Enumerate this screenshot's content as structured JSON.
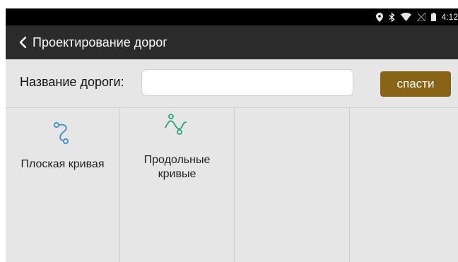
{
  "status_bar": {
    "time": "4:12",
    "icons": [
      "location-icon",
      "bluetooth-icon",
      "wifi-icon",
      "no-signal-icon",
      "battery-icon"
    ]
  },
  "app_bar": {
    "title": "Проектирование дорог",
    "back_icon": "chevron-left-icon"
  },
  "form": {
    "road_name_label": "Название дороги:",
    "road_name_value": "",
    "road_name_placeholder": "",
    "save_label": "спасти"
  },
  "tiles": [
    {
      "label": "Плоская кривая",
      "icon": "plane-curve-icon"
    },
    {
      "label": "Продольные кривые",
      "icon": "longitudinal-curve-icon"
    },
    {
      "label": "",
      "icon": ""
    },
    {
      "label": "",
      "icon": ""
    }
  ],
  "colors": {
    "app_bar": "#2b2b2b",
    "status_bar": "#000000",
    "save_button": "#8a6416",
    "plane_curve_icon": "#3a8fd8",
    "longitudinal_curve_icon": "#2aa37a",
    "background": "#e6e6e6"
  }
}
